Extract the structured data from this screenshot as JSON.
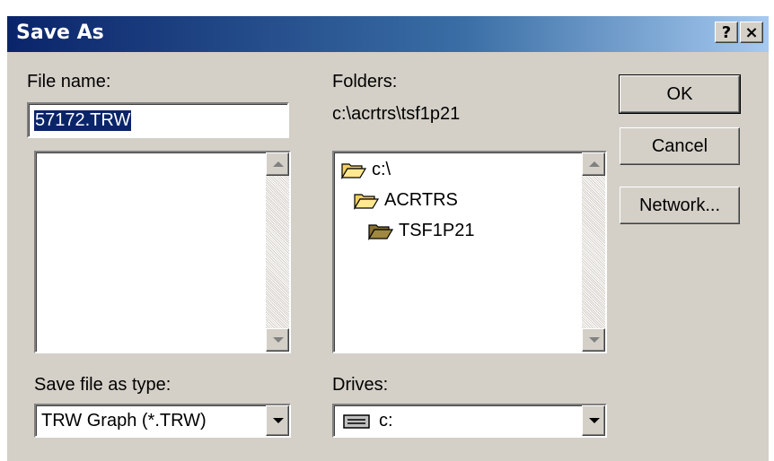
{
  "title": "Save As",
  "title_buttons": {
    "help": "?",
    "close": "×"
  },
  "file_name": {
    "label": "File name:",
    "value": "57172.TRW"
  },
  "folders": {
    "label": "Folders:",
    "current_path": "c:\\acrtrs\\tsf1p21",
    "tree": [
      "c:\\",
      "ACRTRS",
      "TSF1P21"
    ]
  },
  "buttons": {
    "ok": "OK",
    "cancel": "Cancel",
    "network": "Network..."
  },
  "save_type": {
    "label": "Save file as type:",
    "value": "TRW Graph (*.TRW)"
  },
  "drives": {
    "label": "Drives:",
    "value": "c:"
  },
  "icons": [
    "folder-open-icon",
    "drive-icon",
    "scroll-up-icon",
    "scroll-down-icon",
    "dropdown-arrow-icon"
  ]
}
